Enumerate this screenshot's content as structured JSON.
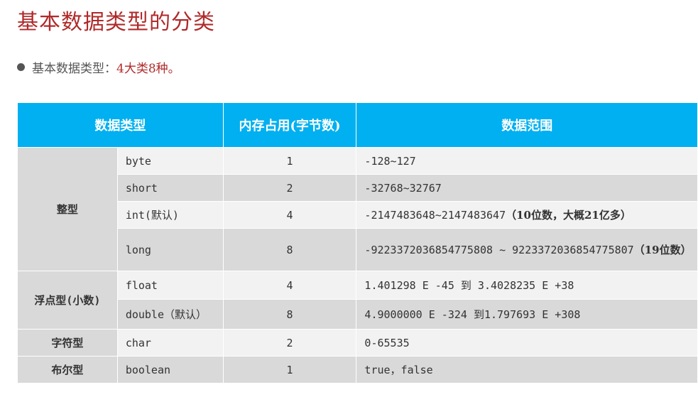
{
  "title": "基本数据类型的分类",
  "bullet": {
    "prefix": "基本数据类型：",
    "accent": "4大类8种。"
  },
  "table": {
    "headers": [
      "数据类型",
      "内存占用(字节数)",
      "数据范围"
    ],
    "categories": {
      "integer": "整型",
      "float": "浮点型(小数)",
      "char": "字符型",
      "bool": "布尔型"
    },
    "rows": [
      {
        "name": "byte",
        "size": "1",
        "range": "-128~127"
      },
      {
        "name": "short",
        "size": "2",
        "range": "-32768~32767"
      },
      {
        "name": "int(默认)",
        "size": "4",
        "range": "-2147483648~2147483647",
        "note": "（10位数，大概21亿多）"
      },
      {
        "name": "long",
        "size": "8",
        "range": "-9223372036854775808 ~ 9223372036854775807",
        "note": "（19位数）"
      },
      {
        "name": "float",
        "size": "4",
        "range": "1.401298 E -45 到 3.4028235 E +38"
      },
      {
        "name": "double（默认）",
        "size": "8",
        "range": "4.9000000 E -324 到1.797693 E +308"
      },
      {
        "name": "char",
        "size": "2",
        "range": "0-65535"
      },
      {
        "name": "boolean",
        "size": "1",
        "range": "true，false"
      }
    ]
  },
  "colors": {
    "title": "#b02a2a",
    "header_bg": "#00b0f0",
    "highlight": "#c00000"
  }
}
